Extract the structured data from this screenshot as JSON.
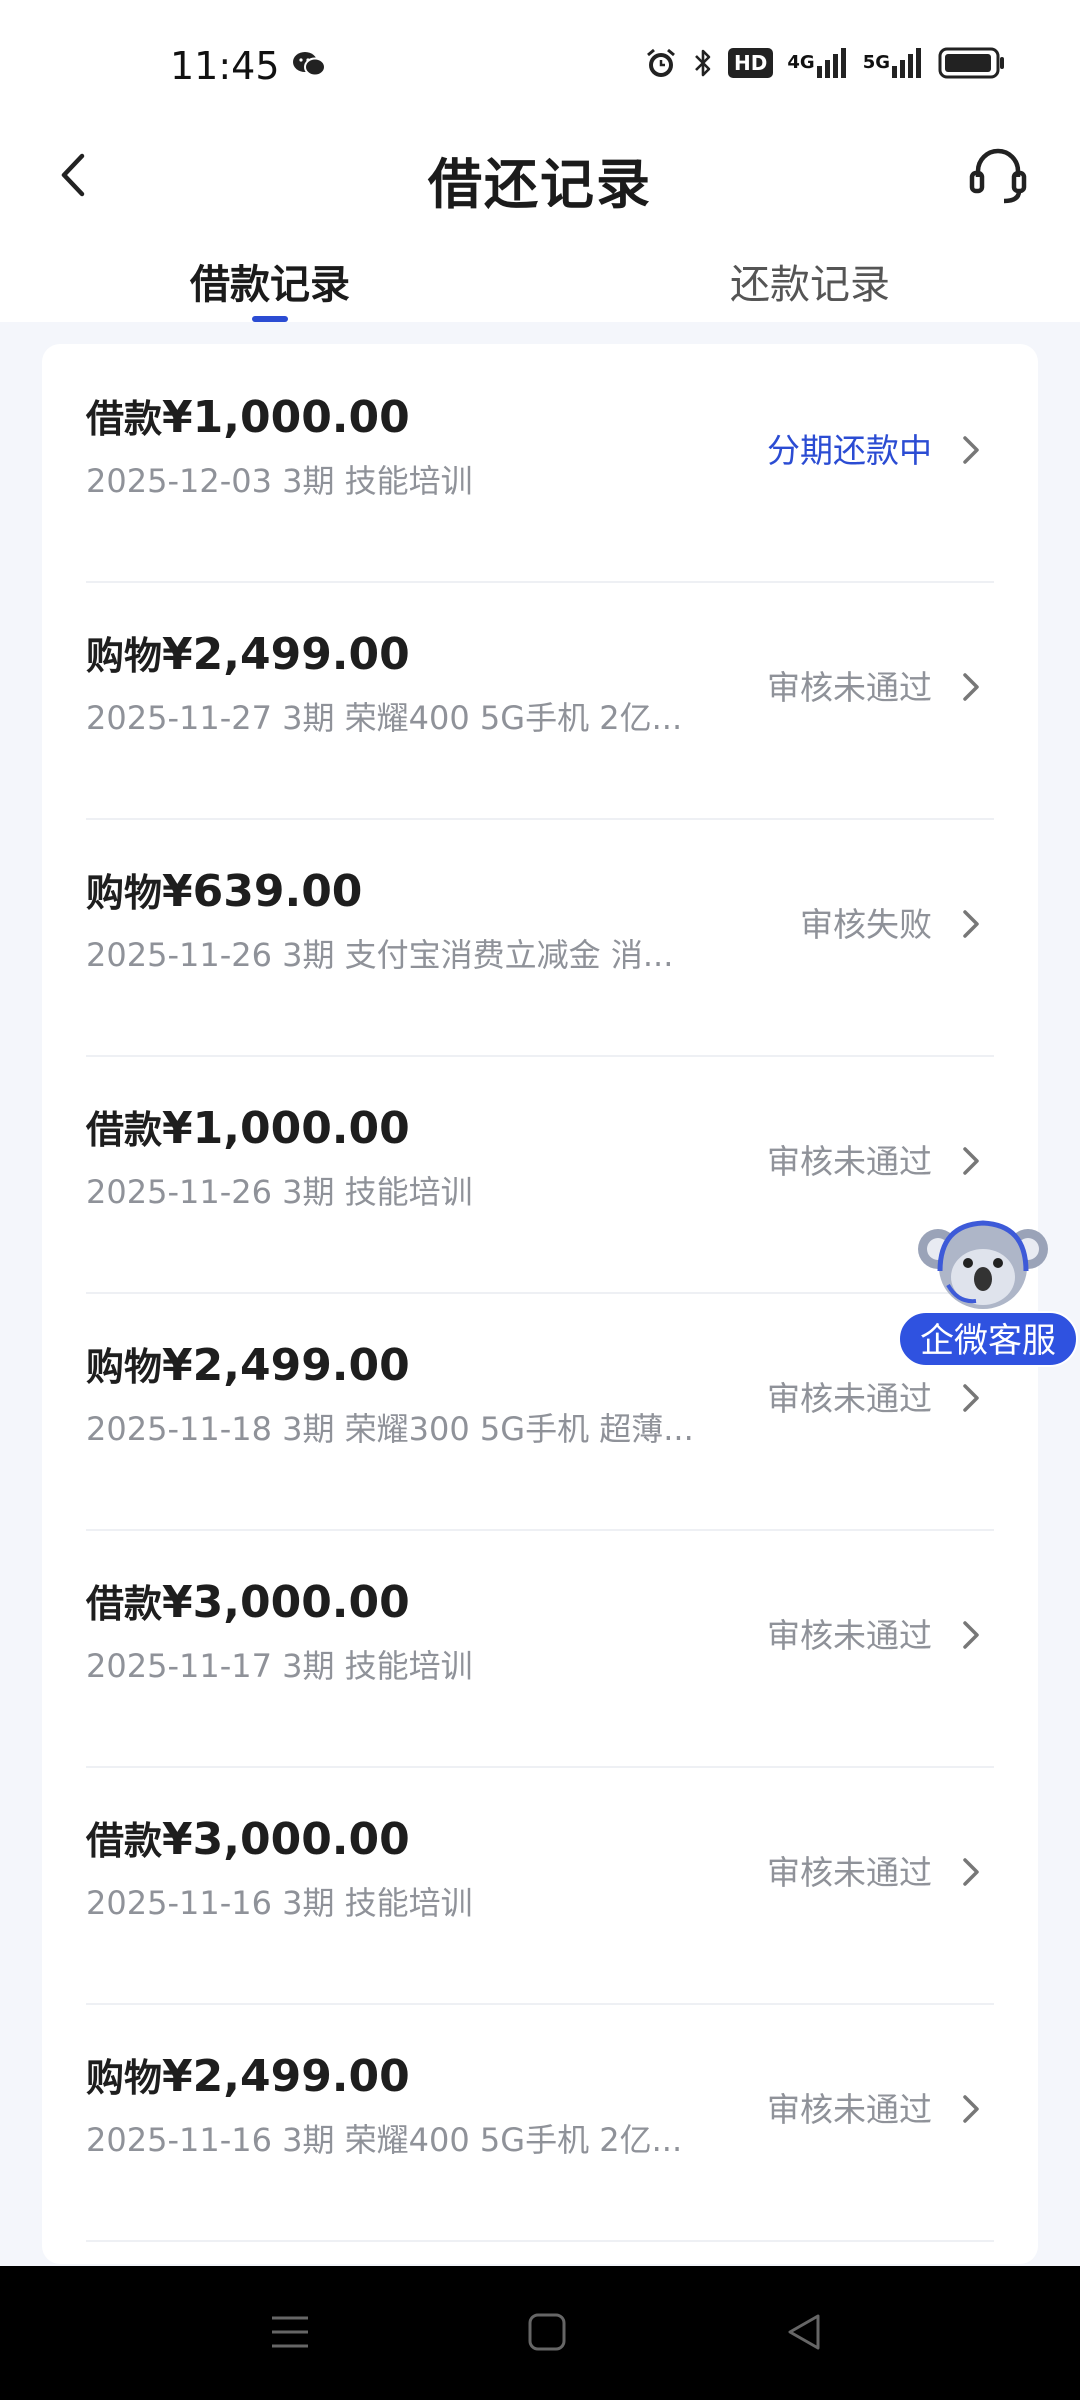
{
  "status_bar": {
    "time": "11:45",
    "net1": "4G",
    "net2": "5G",
    "hd": "HD"
  },
  "header": {
    "title": "借还记录"
  },
  "tabs": [
    {
      "label": "借款记录"
    },
    {
      "label": "还款记录"
    }
  ],
  "colors": {
    "accent": "#2b4cd3",
    "status_gray": "#8f9299"
  },
  "records": [
    {
      "type": "借款",
      "amount": "¥1,000.00",
      "subtitle": "2025-12-03 3期  技能培训",
      "status": "分期还款中",
      "active": true
    },
    {
      "type": "购物",
      "amount": "¥2,499.00",
      "subtitle": "2025-11-27 3期  荣耀400 5G手机 2亿...",
      "status": "审核未通过",
      "active": false
    },
    {
      "type": "购物",
      "amount": "¥639.00",
      "subtitle": "2025-11-26 3期  支付宝消费立减金 消...",
      "status": "审核失败",
      "active": false
    },
    {
      "type": "借款",
      "amount": "¥1,000.00",
      "subtitle": "2025-11-26 3期  技能培训",
      "status": "审核未通过",
      "active": false
    },
    {
      "type": "购物",
      "amount": "¥2,499.00",
      "subtitle": "2025-11-18 3期  荣耀300 5G手机 超薄...",
      "status": "审核未通过",
      "active": false
    },
    {
      "type": "借款",
      "amount": "¥3,000.00",
      "subtitle": "2025-11-17 3期  技能培训",
      "status": "审核未通过",
      "active": false
    },
    {
      "type": "借款",
      "amount": "¥3,000.00",
      "subtitle": "2025-11-16 3期  技能培训",
      "status": "审核未通过",
      "active": false
    },
    {
      "type": "购物",
      "amount": "¥2,499.00",
      "subtitle": "2025-11-16 3期  荣耀400 5G手机 2亿...",
      "status": "审核未通过",
      "active": false
    }
  ],
  "floating_service": {
    "label": "企微客服",
    "icon": "koala-mascot-icon"
  },
  "nav": {
    "icons": [
      "menu-icon",
      "home-square-icon",
      "back-triangle-icon"
    ]
  }
}
